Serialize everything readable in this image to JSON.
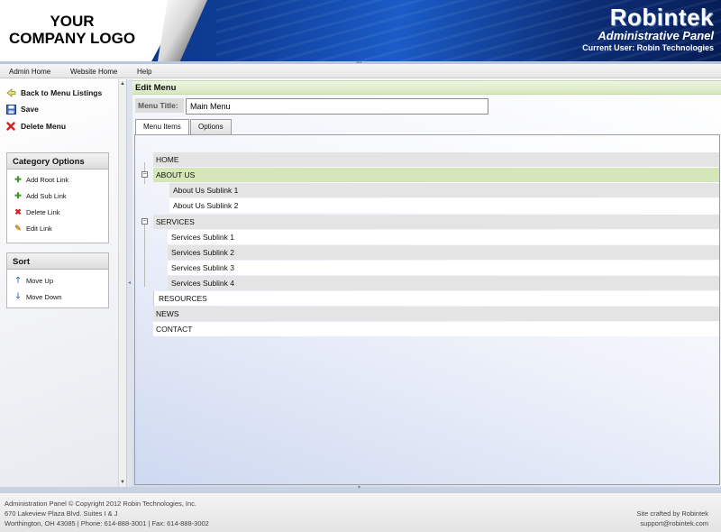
{
  "header": {
    "logo_line1": "YOUR",
    "logo_line2": "COMPANY LOGO",
    "brand_name": "Robintek",
    "brand_subtitle": "Administrative Panel",
    "current_user": "Current User: Robin Technologies"
  },
  "nav": {
    "items": [
      {
        "label": "Admin Home"
      },
      {
        "label": "Website Home"
      },
      {
        "label": "Help"
      }
    ]
  },
  "sidebar": {
    "actions": [
      {
        "label": "Back to Menu Listings",
        "icon": "back-arrow-icon"
      },
      {
        "label": "Save",
        "icon": "save-disk-icon"
      },
      {
        "label": "Delete Menu",
        "icon": "red-x-icon"
      }
    ],
    "category_options": {
      "title": "Category Options",
      "items": [
        {
          "label": "Add Root Link",
          "icon": "plus-icon"
        },
        {
          "label": "Add Sub Link",
          "icon": "plus-icon"
        },
        {
          "label": "Delete Link",
          "icon": "red-x-icon"
        },
        {
          "label": "Edit Link",
          "icon": "pencil-icon"
        }
      ]
    },
    "sort": {
      "title": "Sort",
      "items": [
        {
          "label": "Move Up",
          "icon": "arrow-up-icon"
        },
        {
          "label": "Move Down",
          "icon": "arrow-down-icon"
        }
      ]
    }
  },
  "main": {
    "title": "Edit Menu",
    "menu_title_label": "Menu Title:",
    "menu_title_value": "Main Menu",
    "tabs": [
      {
        "label": "Menu Items",
        "active": true
      },
      {
        "label": "Options",
        "active": false
      }
    ],
    "tree": [
      {
        "label": "HOME",
        "level": 0
      },
      {
        "label": "ABOUT US",
        "level": 0,
        "expanded": true,
        "selected": true
      },
      {
        "label": "About Us  Sublink 1",
        "level": 1
      },
      {
        "label": "About Us  Sublink 2",
        "level": 1
      },
      {
        "label": "SERVICES",
        "level": 0,
        "expanded": true
      },
      {
        "label": "Services Sublink 1",
        "level": 1
      },
      {
        "label": "Services Sublink 2",
        "level": 1
      },
      {
        "label": "Services Sublink 3",
        "level": 1
      },
      {
        "label": "Services Sublink 4",
        "level": 1
      },
      {
        "label": "RESOURCES",
        "level": 0
      },
      {
        "label": "NEWS",
        "level": 0
      },
      {
        "label": "CONTACT",
        "level": 0
      }
    ],
    "toggle_symbol": "⊟"
  },
  "footer": {
    "line1": "Administration Panel © Copyright 2012 Robin Technologies, Inc.",
    "line2": "670 Lakeview Plaza Blvd. Suites I & J",
    "line3": "Worthington, OH 43085 | Phone: 614-888-3001 | Fax: 614-888-3002",
    "credit": "Site crafted by Robintek",
    "email": "support@robintek.com"
  },
  "colors": {
    "header_blue": "#0f3f9a",
    "title_bar_green": "#d6e8bf",
    "selected_row": "#d5e6b9",
    "delete_red": "#d62020"
  }
}
